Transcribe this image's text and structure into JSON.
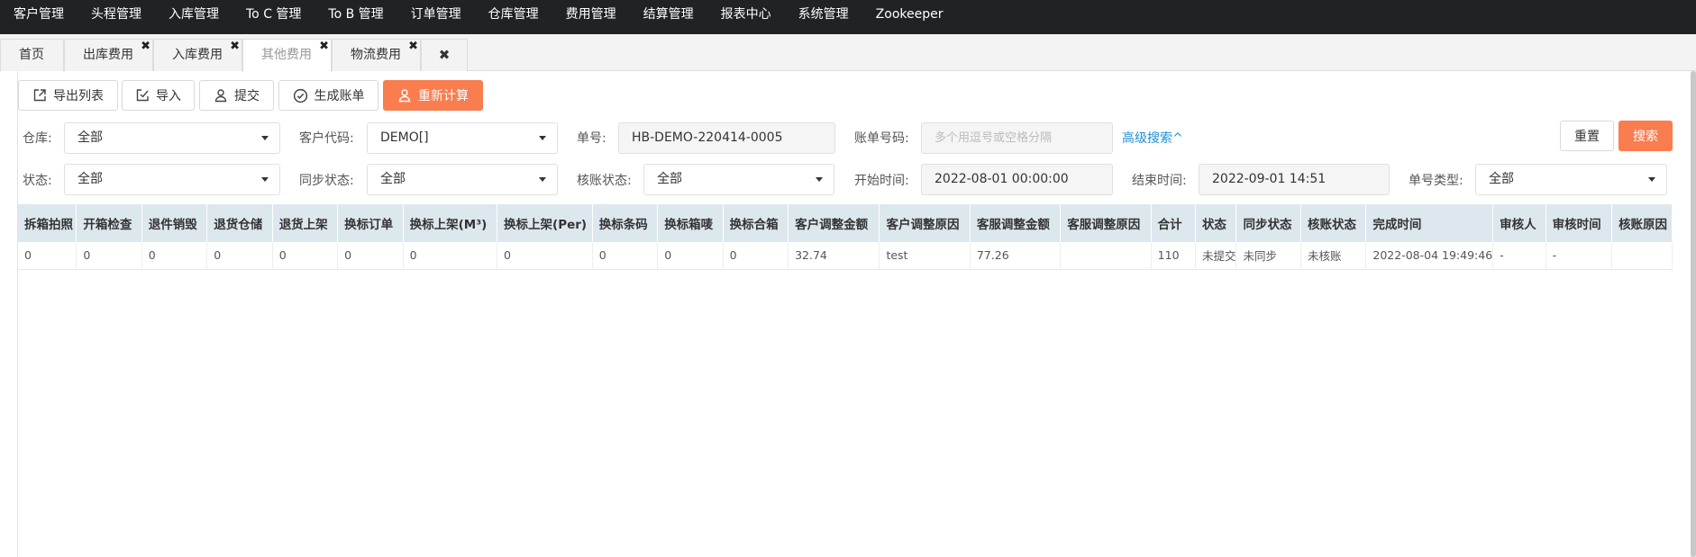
{
  "topnav": {
    "items": [
      "客户管理",
      "头程管理",
      "入库管理",
      "To C 管理",
      "To B 管理",
      "订单管理",
      "仓库管理",
      "费用管理",
      "结算管理",
      "报表中心",
      "系统管理",
      "Zookeeper"
    ]
  },
  "tabs": {
    "home": "首页",
    "outbound_fee": "出库费用",
    "inbound_fee": "入库费用",
    "other_fee": "其他费用",
    "logistics_fee": "物流费用",
    "close_symbol": "✖"
  },
  "toolbar": {
    "export_list": "导出列表",
    "import": "导入",
    "submit": "提交",
    "generate_bill": "生成账单",
    "recalculate": "重新计算",
    "accent_color": "#fa7d4f"
  },
  "filters": {
    "warehouse": {
      "label": "仓库:",
      "value": "全部"
    },
    "customer_code": {
      "label": "客户代码:",
      "value": "DEMO[]"
    },
    "order_no": {
      "label": "单号:",
      "value": "HB-DEMO-220414-0005"
    },
    "bill_no": {
      "label": "账单号码:",
      "placeholder": "多个用逗号或空格分隔"
    },
    "advanced_search": "高级搜索^",
    "reset": "重置",
    "search": "搜索",
    "status": {
      "label": "状态:",
      "value": "全部"
    },
    "sync_status": {
      "label": "同步状态:",
      "value": "全部"
    },
    "check_status": {
      "label": "核账状态:",
      "value": "全部"
    },
    "start_time": {
      "label": "开始时间:",
      "value": "2022-08-01 00:00:00"
    },
    "end_time": {
      "label": "结束时间:",
      "value": "2022-09-01 14:51"
    },
    "order_type": {
      "label": "单号类型:",
      "value": "全部"
    }
  },
  "table": {
    "columns": [
      "拆箱拍照",
      "开箱检查",
      "退件销毁",
      "退货仓储",
      "退货上架",
      "换标订单",
      "换标上架(M³)",
      "换标上架(Per)",
      "换标条码",
      "换标箱唛",
      "换标合箱",
      "客户调整金额",
      "客户调整原因",
      "客服调整金额",
      "客服调整原因",
      "合计",
      "状态",
      "同步状态",
      "核账状态",
      "完成时间",
      "审核人",
      "审核时间",
      "核账原因"
    ],
    "rows": [
      [
        "0",
        "0",
        "0",
        "0",
        "0",
        "0",
        "0",
        "0",
        "0",
        "0",
        "0",
        "32.74",
        "test",
        "77.26",
        "",
        "110",
        "未提交",
        "未同步",
        "未核账",
        "2022-08-04 19:49:46",
        "-",
        "-",
        ""
      ]
    ]
  }
}
